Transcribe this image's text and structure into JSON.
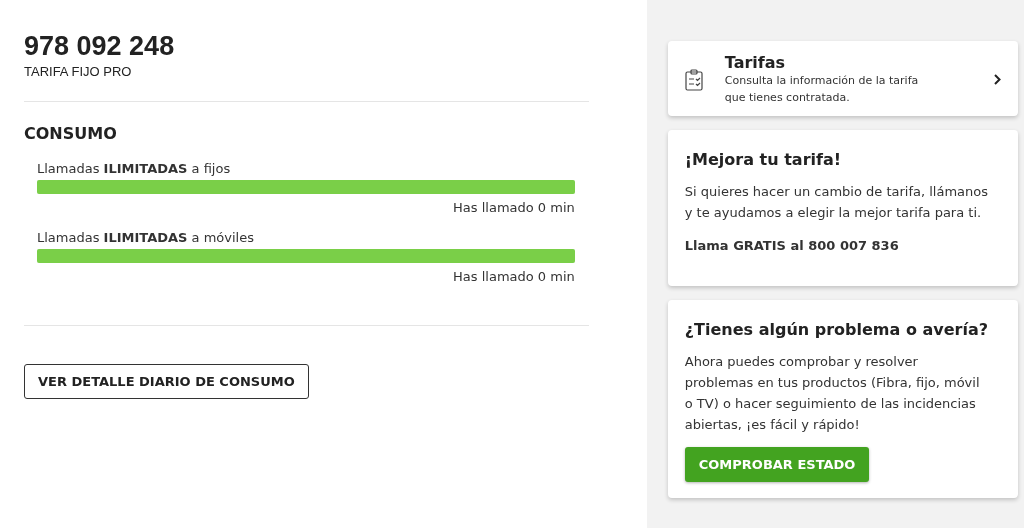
{
  "line": {
    "number": "978 092 248",
    "plan": "TARIFA FIJO PRO"
  },
  "consumo": {
    "title": "CONSUMO",
    "items": [
      {
        "label": "Llamadas **ILIMITADAS** a fijos",
        "level": 1,
        "reading": "Has llamado 0 min"
      },
      {
        "label": "Llamadas **ILIMITADAS** a móviles",
        "level": 1,
        "reading": "Has llamado 0 min"
      }
    ],
    "button": "VER DETALLE DIARIO DE CONSUMO"
  },
  "sidebar": {
    "tarifas": {
      "title": "Tarifas",
      "description": "Consulta la información de la tarifa que tienes contratada."
    },
    "cards": [
      {
        "title": "¡Mejora tu tarifa!",
        "text": "Si quieres hacer un cambio de tarifa, llámanos y te ayudamos a elegir la mejor tarifa para ti.",
        "note": "Llama GRATIS al 800 007 836"
      },
      {
        "title": "¿Tienes algún problema o avería?",
        "text": "Ahora puedes comprobar y resolver problemas en tus productos (Fibra, fijo, móvil o TV) o hacer seguimiento de las incidencias abiertas, ¡es fácil y rápido!",
        "button": "COMPROBAR ESTADO"
      }
    ]
  }
}
